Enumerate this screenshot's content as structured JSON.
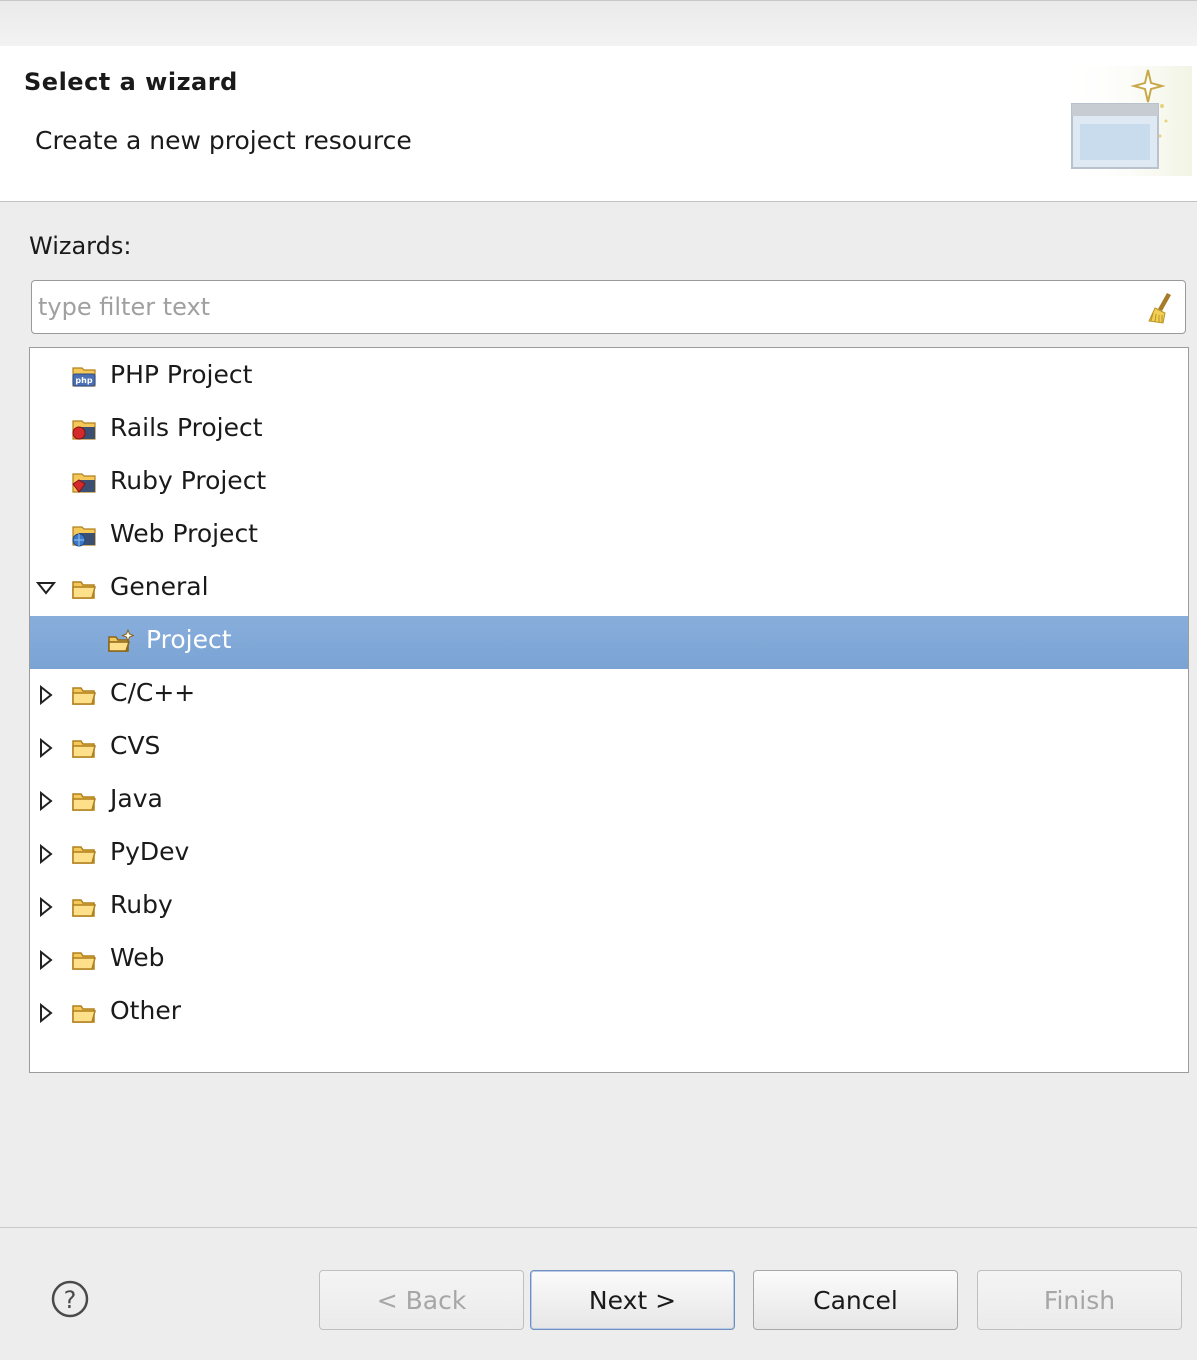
{
  "header": {
    "title": "Select a wizard",
    "subtitle": "Create a new project resource"
  },
  "wizards_label": "Wizards:",
  "filter": {
    "placeholder": "type filter text",
    "value": ""
  },
  "tree": {
    "items": [
      {
        "label": "PHP Project",
        "icon": "php-project-icon",
        "kind": "item",
        "level": 0
      },
      {
        "label": "Rails Project",
        "icon": "rails-project-icon",
        "kind": "item",
        "level": 0
      },
      {
        "label": "Ruby Project",
        "icon": "ruby-project-icon",
        "kind": "item",
        "level": 0
      },
      {
        "label": "Web Project",
        "icon": "web-project-icon",
        "kind": "item",
        "level": 0
      },
      {
        "label": "General",
        "icon": "folder-icon",
        "kind": "folder",
        "expanded": true,
        "level": 0
      },
      {
        "label": "Project",
        "icon": "new-project-icon",
        "kind": "item",
        "level": 1,
        "selected": true
      },
      {
        "label": "C/C++",
        "icon": "folder-icon",
        "kind": "folder",
        "expanded": false,
        "level": 0
      },
      {
        "label": "CVS",
        "icon": "folder-icon",
        "kind": "folder",
        "expanded": false,
        "level": 0
      },
      {
        "label": "Java",
        "icon": "folder-icon",
        "kind": "folder",
        "expanded": false,
        "level": 0
      },
      {
        "label": "PyDev",
        "icon": "folder-icon",
        "kind": "folder",
        "expanded": false,
        "level": 0
      },
      {
        "label": "Ruby",
        "icon": "folder-icon",
        "kind": "folder",
        "expanded": false,
        "level": 0
      },
      {
        "label": "Web",
        "icon": "folder-icon",
        "kind": "folder",
        "expanded": false,
        "level": 0
      },
      {
        "label": "Other",
        "icon": "folder-icon",
        "kind": "folder",
        "expanded": false,
        "level": 0
      }
    ]
  },
  "buttons": {
    "back": "< Back",
    "next": "Next >",
    "cancel": "Cancel",
    "finish": "Finish"
  },
  "colors": {
    "selection": "#7aa3d4",
    "folder": "#f0b040",
    "disabled_text": "#a6a6a6"
  }
}
